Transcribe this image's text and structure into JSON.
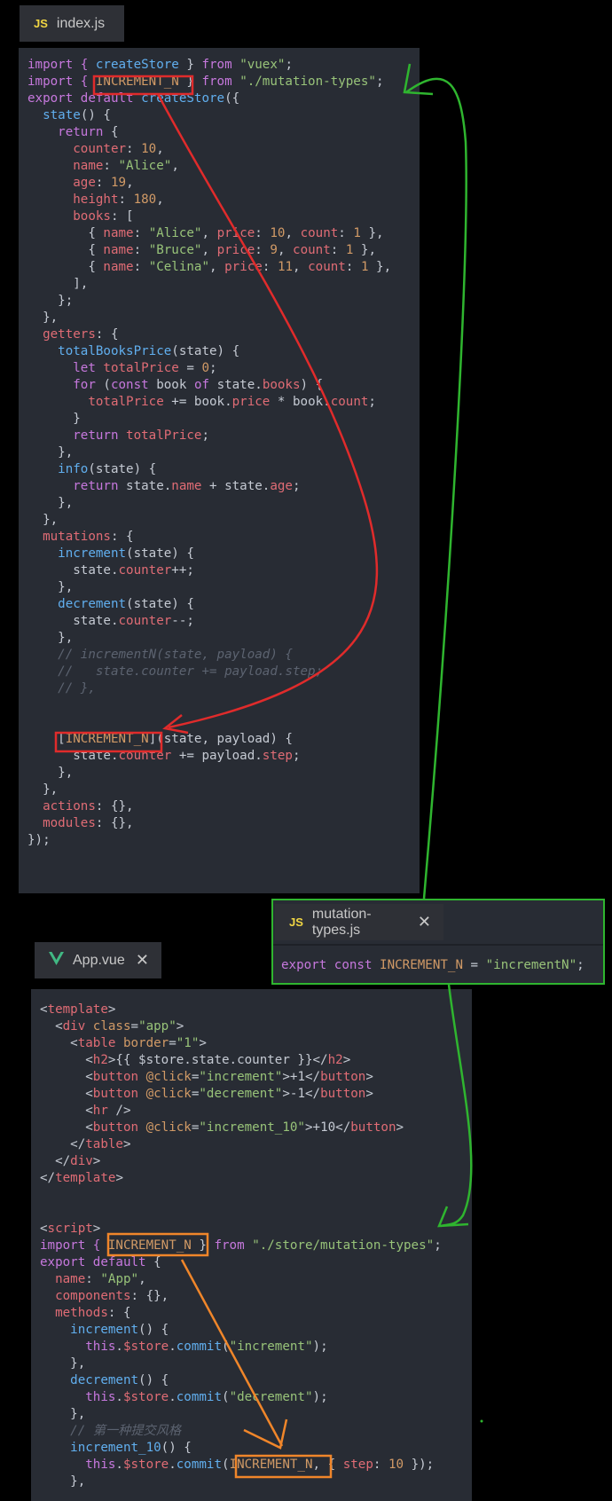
{
  "tabs": {
    "index": {
      "badge": "JS",
      "label": "index.js"
    },
    "mutation_types": {
      "badge": "JS",
      "label": "mutation-types.js",
      "close": "✕"
    },
    "app": {
      "label": "App.vue",
      "close": "✕"
    }
  },
  "colors": {
    "red_annotation": "#e02b2b",
    "green_annotation": "#2fb52f",
    "orange_annotation": "#f0862a",
    "panel_bg": "#282c34",
    "keyword": "#c678dd",
    "function": "#61afef",
    "string": "#98c379",
    "number": "#d19a66",
    "property": "#e06c75",
    "comment": "#5c6370"
  },
  "index_code": [
    [
      [
        "import { ",
        "k"
      ],
      [
        "createStore",
        "f"
      ],
      [
        " } ",
        "w"
      ],
      [
        "from ",
        "k"
      ],
      [
        "\"vuex\"",
        "s"
      ],
      [
        ";",
        "w"
      ]
    ],
    [
      [
        "import { ",
        "k"
      ],
      [
        "INCREMENT_N",
        "n"
      ],
      [
        " } ",
        "w"
      ],
      [
        "from ",
        "k"
      ],
      [
        "\"./mutation-types\"",
        "s"
      ],
      [
        ";",
        "w"
      ]
    ],
    [
      [
        "export default ",
        "k"
      ],
      [
        "createStore",
        "f"
      ],
      [
        "({",
        "w"
      ]
    ],
    [
      [
        "  ",
        "w"
      ],
      [
        "state",
        "f"
      ],
      [
        "() {",
        "w"
      ]
    ],
    [
      [
        "    ",
        "w"
      ],
      [
        "return",
        "k"
      ],
      [
        " {",
        "w"
      ]
    ],
    [
      [
        "      ",
        "w"
      ],
      [
        "counter",
        "p"
      ],
      [
        ": ",
        "w"
      ],
      [
        "10",
        "n"
      ],
      [
        ",",
        "w"
      ]
    ],
    [
      [
        "      ",
        "w"
      ],
      [
        "name",
        "p"
      ],
      [
        ": ",
        "w"
      ],
      [
        "\"Alice\"",
        "s"
      ],
      [
        ",",
        "w"
      ]
    ],
    [
      [
        "      ",
        "w"
      ],
      [
        "age",
        "p"
      ],
      [
        ": ",
        "w"
      ],
      [
        "19",
        "n"
      ],
      [
        ",",
        "w"
      ]
    ],
    [
      [
        "      ",
        "w"
      ],
      [
        "height",
        "p"
      ],
      [
        ": ",
        "w"
      ],
      [
        "180",
        "n"
      ],
      [
        ",",
        "w"
      ]
    ],
    [
      [
        "      ",
        "w"
      ],
      [
        "books",
        "p"
      ],
      [
        ": [",
        "w"
      ]
    ],
    [
      [
        "        { ",
        "w"
      ],
      [
        "name",
        "p"
      ],
      [
        ": ",
        "w"
      ],
      [
        "\"Alice\"",
        "s"
      ],
      [
        ", ",
        "w"
      ],
      [
        "price",
        "p"
      ],
      [
        ": ",
        "w"
      ],
      [
        "10",
        "n"
      ],
      [
        ", ",
        "w"
      ],
      [
        "count",
        "p"
      ],
      [
        ": ",
        "w"
      ],
      [
        "1",
        "n"
      ],
      [
        " },",
        "w"
      ]
    ],
    [
      [
        "        { ",
        "w"
      ],
      [
        "name",
        "p"
      ],
      [
        ": ",
        "w"
      ],
      [
        "\"Bruce\"",
        "s"
      ],
      [
        ", ",
        "w"
      ],
      [
        "price",
        "p"
      ],
      [
        ": ",
        "w"
      ],
      [
        "9",
        "n"
      ],
      [
        ", ",
        "w"
      ],
      [
        "count",
        "p"
      ],
      [
        ": ",
        "w"
      ],
      [
        "1",
        "n"
      ],
      [
        " },",
        "w"
      ]
    ],
    [
      [
        "        { ",
        "w"
      ],
      [
        "name",
        "p"
      ],
      [
        ": ",
        "w"
      ],
      [
        "\"Celina\"",
        "s"
      ],
      [
        ", ",
        "w"
      ],
      [
        "price",
        "p"
      ],
      [
        ": ",
        "w"
      ],
      [
        "11",
        "n"
      ],
      [
        ", ",
        "w"
      ],
      [
        "count",
        "p"
      ],
      [
        ": ",
        "w"
      ],
      [
        "1",
        "n"
      ],
      [
        " },",
        "w"
      ]
    ],
    [
      [
        "      ],",
        "w"
      ]
    ],
    [
      [
        "    };",
        "w"
      ]
    ],
    [
      [
        "  },",
        "w"
      ]
    ],
    [
      [
        "  ",
        "w"
      ],
      [
        "getters",
        "p"
      ],
      [
        ": {",
        "w"
      ]
    ],
    [
      [
        "    ",
        "w"
      ],
      [
        "totalBooksPrice",
        "f"
      ],
      [
        "(state) {",
        "w"
      ]
    ],
    [
      [
        "      ",
        "w"
      ],
      [
        "let ",
        "k"
      ],
      [
        "totalPrice",
        "p"
      ],
      [
        " = ",
        "w"
      ],
      [
        "0",
        "n"
      ],
      [
        ";",
        "w"
      ]
    ],
    [
      [
        "      ",
        "w"
      ],
      [
        "for ",
        "k"
      ],
      [
        "(",
        "w"
      ],
      [
        "const ",
        "k"
      ],
      [
        "book ",
        "w"
      ],
      [
        "of ",
        "k"
      ],
      [
        "state.",
        "w"
      ],
      [
        "books",
        "p"
      ],
      [
        ") {",
        "w"
      ]
    ],
    [
      [
        "        ",
        "w"
      ],
      [
        "totalPrice",
        "p"
      ],
      [
        " += book.",
        "w"
      ],
      [
        "price",
        "p"
      ],
      [
        " * book.",
        "w"
      ],
      [
        "count",
        "p"
      ],
      [
        ";",
        "w"
      ]
    ],
    [
      [
        "      }",
        "w"
      ]
    ],
    [
      [
        "      ",
        "w"
      ],
      [
        "return ",
        "k"
      ],
      [
        "totalPrice",
        "p"
      ],
      [
        ";",
        "w"
      ]
    ],
    [
      [
        "    },",
        "w"
      ]
    ],
    [
      [
        "    ",
        "w"
      ],
      [
        "info",
        "f"
      ],
      [
        "(state) {",
        "w"
      ]
    ],
    [
      [
        "      ",
        "w"
      ],
      [
        "return ",
        "k"
      ],
      [
        "state.",
        "w"
      ],
      [
        "name",
        "p"
      ],
      [
        " + state.",
        "w"
      ],
      [
        "age",
        "p"
      ],
      [
        ";",
        "w"
      ]
    ],
    [
      [
        "    },",
        "w"
      ]
    ],
    [
      [
        "  },",
        "w"
      ]
    ],
    [
      [
        "  ",
        "w"
      ],
      [
        "mutations",
        "p"
      ],
      [
        ": {",
        "w"
      ]
    ],
    [
      [
        "    ",
        "w"
      ],
      [
        "increment",
        "f"
      ],
      [
        "(state) {",
        "w"
      ]
    ],
    [
      [
        "      state.",
        "w"
      ],
      [
        "counter",
        "p"
      ],
      [
        "++;",
        "w"
      ]
    ],
    [
      [
        "    },",
        "w"
      ]
    ],
    [
      [
        "    ",
        "w"
      ],
      [
        "decrement",
        "f"
      ],
      [
        "(state) {",
        "w"
      ]
    ],
    [
      [
        "      state.",
        "w"
      ],
      [
        "counter",
        "p"
      ],
      [
        "--;",
        "w"
      ]
    ],
    [
      [
        "    },",
        "w"
      ]
    ],
    [
      [
        "    // incrementN(state, payload) {",
        "c"
      ]
    ],
    [
      [
        "    //   state.counter += payload.step;",
        "c"
      ]
    ],
    [
      [
        "    // },",
        "c"
      ]
    ],
    [
      [
        "",
        "w"
      ]
    ],
    [
      [
        "",
        "w"
      ]
    ],
    [
      [
        "    [",
        "w"
      ],
      [
        "INCREMENT_N",
        "n"
      ],
      [
        "](state, payload) {",
        "w"
      ]
    ],
    [
      [
        "      state.",
        "w"
      ],
      [
        "counter",
        "p"
      ],
      [
        " += payload.",
        "w"
      ],
      [
        "step",
        "p"
      ],
      [
        ";",
        "w"
      ]
    ],
    [
      [
        "    },",
        "w"
      ]
    ],
    [
      [
        "  },",
        "w"
      ]
    ],
    [
      [
        "  ",
        "w"
      ],
      [
        "actions",
        "p"
      ],
      [
        ": {},",
        "w"
      ]
    ],
    [
      [
        "  ",
        "w"
      ],
      [
        "modules",
        "p"
      ],
      [
        ": {},",
        "w"
      ]
    ],
    [
      [
        "});",
        "w"
      ]
    ]
  ],
  "mutation_types_code": [
    [
      [
        "export const ",
        "k"
      ],
      [
        "INCREMENT_N",
        "n"
      ],
      [
        " = ",
        "w"
      ],
      [
        "\"incrementN\"",
        "s"
      ],
      [
        ";",
        "w"
      ]
    ]
  ],
  "app_code": [
    [
      [
        "<",
        "w"
      ],
      [
        "template",
        "t"
      ],
      [
        ">",
        "w"
      ]
    ],
    [
      [
        "  <",
        "w"
      ],
      [
        "div ",
        "t"
      ],
      [
        "class",
        "a"
      ],
      [
        "=",
        "w"
      ],
      [
        "\"app\"",
        "s"
      ],
      [
        ">",
        "w"
      ]
    ],
    [
      [
        "    <",
        "w"
      ],
      [
        "table ",
        "t"
      ],
      [
        "border",
        "a"
      ],
      [
        "=",
        "w"
      ],
      [
        "\"1\"",
        "s"
      ],
      [
        ">",
        "w"
      ]
    ],
    [
      [
        "      <",
        "w"
      ],
      [
        "h2",
        "t"
      ],
      [
        ">{{ $store.state.counter }}</",
        "w"
      ],
      [
        "h2",
        "t"
      ],
      [
        ">",
        "w"
      ]
    ],
    [
      [
        "      <",
        "w"
      ],
      [
        "button ",
        "t"
      ],
      [
        "@click",
        "a"
      ],
      [
        "=",
        "w"
      ],
      [
        "\"increment\"",
        "s"
      ],
      [
        ">+1</",
        "w"
      ],
      [
        "button",
        "t"
      ],
      [
        ">",
        "w"
      ]
    ],
    [
      [
        "      <",
        "w"
      ],
      [
        "button ",
        "t"
      ],
      [
        "@click",
        "a"
      ],
      [
        "=",
        "w"
      ],
      [
        "\"decrement\"",
        "s"
      ],
      [
        ">-1</",
        "w"
      ],
      [
        "button",
        "t"
      ],
      [
        ">",
        "w"
      ]
    ],
    [
      [
        "      <",
        "w"
      ],
      [
        "hr ",
        "t"
      ],
      [
        "/>",
        "w"
      ]
    ],
    [
      [
        "      <",
        "w"
      ],
      [
        "button ",
        "t"
      ],
      [
        "@click",
        "a"
      ],
      [
        "=",
        "w"
      ],
      [
        "\"increment_10\"",
        "s"
      ],
      [
        ">+10</",
        "w"
      ],
      [
        "button",
        "t"
      ],
      [
        ">",
        "w"
      ]
    ],
    [
      [
        "    </",
        "w"
      ],
      [
        "table",
        "t"
      ],
      [
        ">",
        "w"
      ]
    ],
    [
      [
        "  </",
        "w"
      ],
      [
        "div",
        "t"
      ],
      [
        ">",
        "w"
      ]
    ],
    [
      [
        "</",
        "w"
      ],
      [
        "template",
        "t"
      ],
      [
        ">",
        "w"
      ]
    ],
    [
      [
        "",
        "w"
      ]
    ],
    [
      [
        "",
        "w"
      ]
    ],
    [
      [
        "<",
        "w"
      ],
      [
        "script",
        "t"
      ],
      [
        ">",
        "w"
      ]
    ],
    [
      [
        "import { ",
        "k"
      ],
      [
        "INCREMENT_N",
        "n"
      ],
      [
        " } ",
        "w"
      ],
      [
        "from ",
        "k"
      ],
      [
        "\"./store/mutation-types\"",
        "s"
      ],
      [
        ";",
        "w"
      ]
    ],
    [
      [
        "export default ",
        "k"
      ],
      [
        "{",
        "w"
      ]
    ],
    [
      [
        "  ",
        "w"
      ],
      [
        "name",
        "p"
      ],
      [
        ": ",
        "w"
      ],
      [
        "\"App\"",
        "s"
      ],
      [
        ",",
        "w"
      ]
    ],
    [
      [
        "  ",
        "w"
      ],
      [
        "components",
        "p"
      ],
      [
        ": {},",
        "w"
      ]
    ],
    [
      [
        "  ",
        "w"
      ],
      [
        "methods",
        "p"
      ],
      [
        ": {",
        "w"
      ]
    ],
    [
      [
        "    ",
        "w"
      ],
      [
        "increment",
        "f"
      ],
      [
        "() {",
        "w"
      ]
    ],
    [
      [
        "      ",
        "w"
      ],
      [
        "this",
        "k"
      ],
      [
        ".",
        "w"
      ],
      [
        "$store",
        "p"
      ],
      [
        ".",
        "w"
      ],
      [
        "commit",
        "f"
      ],
      [
        "(",
        "w"
      ],
      [
        "\"increment\"",
        "s"
      ],
      [
        ");",
        "w"
      ]
    ],
    [
      [
        "    },",
        "w"
      ]
    ],
    [
      [
        "    ",
        "w"
      ],
      [
        "decrement",
        "f"
      ],
      [
        "() {",
        "w"
      ]
    ],
    [
      [
        "      ",
        "w"
      ],
      [
        "this",
        "k"
      ],
      [
        ".",
        "w"
      ],
      [
        "$store",
        "p"
      ],
      [
        ".",
        "w"
      ],
      [
        "commit",
        "f"
      ],
      [
        "(",
        "w"
      ],
      [
        "\"decrement\"",
        "s"
      ],
      [
        ");",
        "w"
      ]
    ],
    [
      [
        "    },",
        "w"
      ]
    ],
    [
      [
        "    // 第一种提交风格",
        "c"
      ]
    ],
    [
      [
        "    ",
        "w"
      ],
      [
        "increment_10",
        "f"
      ],
      [
        "() {",
        "w"
      ]
    ],
    [
      [
        "      ",
        "w"
      ],
      [
        "this",
        "k"
      ],
      [
        ".",
        "w"
      ],
      [
        "$store",
        "p"
      ],
      [
        ".",
        "w"
      ],
      [
        "commit",
        "f"
      ],
      [
        "(",
        "w"
      ],
      [
        "INCREMENT_N",
        "n"
      ],
      [
        ", { ",
        "w"
      ],
      [
        "step",
        "p"
      ],
      [
        ": ",
        "w"
      ],
      [
        "10",
        "n"
      ],
      [
        " });",
        "w"
      ]
    ],
    [
      [
        "    },",
        "w"
      ]
    ]
  ]
}
